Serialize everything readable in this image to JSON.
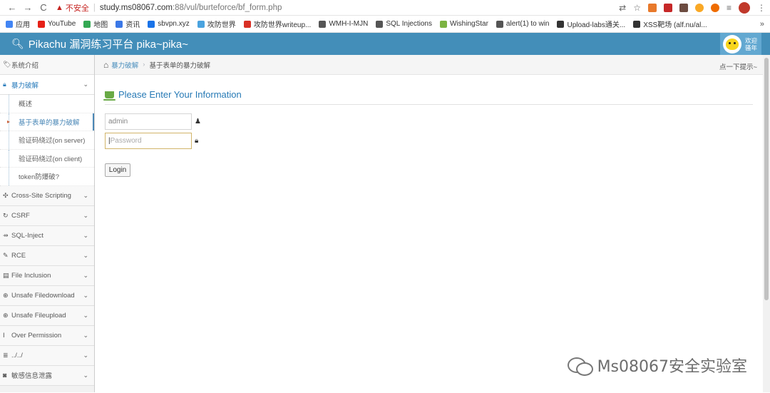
{
  "browser": {
    "back": "←",
    "forward": "→",
    "reload": "C",
    "insecure_label": "不安全",
    "url_host": "study.ms08067.com",
    "url_path": ":88/vul/burteforce/bf_form.php",
    "more_menu": "⋮"
  },
  "bookmarks": [
    {
      "label": "应用",
      "color": "#4285f4"
    },
    {
      "label": "YouTube",
      "color": "#e62117"
    },
    {
      "label": "地图",
      "color": "#34a853"
    },
    {
      "label": "资讯",
      "color": "#3b78e7"
    },
    {
      "label": "sbvpn.xyz",
      "color": "#1a73e8"
    },
    {
      "label": "攻防世界",
      "color": "#4aa3df"
    },
    {
      "label": "攻防世界writeup...",
      "color": "#d93025"
    },
    {
      "label": "WMH-I-MJN",
      "color": "#555555"
    },
    {
      "label": "SQL Injections",
      "color": "#555555"
    },
    {
      "label": "WishingStar",
      "color": "#7cb342"
    },
    {
      "label": "alert(1) to win",
      "color": "#555555"
    },
    {
      "label": "Upload-labs通关...",
      "color": "#333333"
    },
    {
      "label": "XSS靶场 (alf.nu/al...",
      "color": "#333333"
    }
  ],
  "bookmarks_more": "»",
  "app": {
    "title": "Pikachu 漏洞练习平台 pika~pika~",
    "welcome_line1": "欢迎",
    "welcome_line2": "骚年"
  },
  "sidebar": {
    "items": [
      {
        "label": "系统介绍",
        "icon": "tag-icon"
      },
      {
        "label": "暴力破解",
        "icon": "lock-icon",
        "active": true
      },
      {
        "label": "Cross-Site Scripting",
        "icon": "xss-icon"
      },
      {
        "label": "CSRF",
        "icon": "share-icon"
      },
      {
        "label": "SQL-Inject",
        "icon": "inject-icon"
      },
      {
        "label": "RCE",
        "icon": "pencil-icon"
      },
      {
        "label": "File Inclusion",
        "icon": "file-icon"
      },
      {
        "label": "Unsafe Filedownload",
        "icon": "download-icon"
      },
      {
        "label": "Unsafe Fileupload",
        "icon": "upload-icon"
      },
      {
        "label": "Over Permission",
        "icon": "text-icon"
      },
      {
        "label": "../../",
        "icon": "list-icon"
      },
      {
        "label": "敏感信息泄露",
        "icon": "camera-icon"
      }
    ],
    "subitems": [
      {
        "label": "概述"
      },
      {
        "label": "基于表单的暴力破解",
        "current": true
      },
      {
        "label": "验证码绕过(on server)"
      },
      {
        "label": "验证码绕过(on client)"
      },
      {
        "label": "token防爆破?"
      }
    ]
  },
  "breadcrumb": {
    "parent": "暴力破解",
    "current": "基于表单的暴力破解",
    "hint": "点一下提示~"
  },
  "form": {
    "title": "Please Enter Your Information",
    "username_value": "admin",
    "password_placeholder": "Password",
    "login_label": "Login"
  },
  "watermark": "Ms08067安全实验室"
}
